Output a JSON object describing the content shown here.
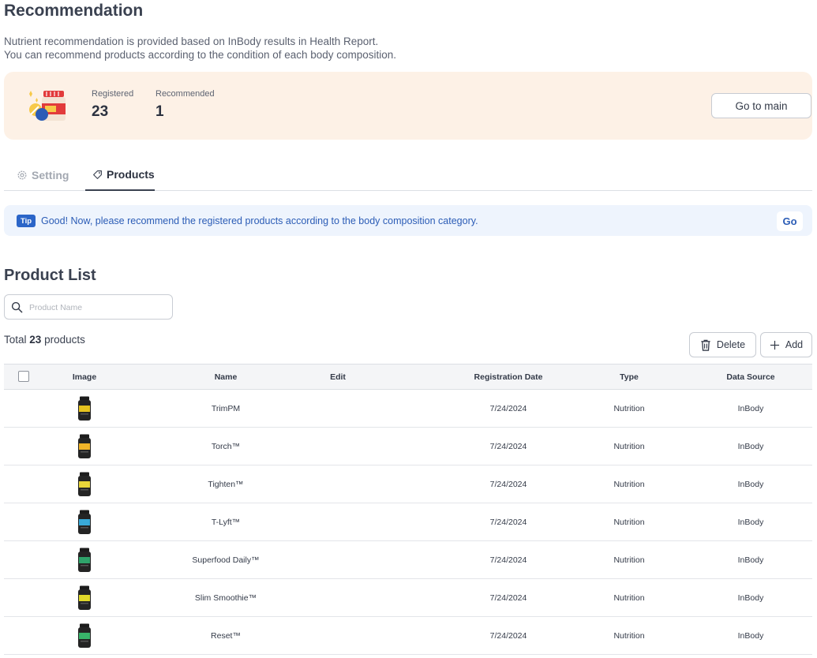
{
  "header": {
    "title": "Recommendation",
    "desc_line1": "Nutrient recommendation is provided based on InBody results in Health Report.",
    "desc_line2": "You can recommend products according to the condition of each body composition."
  },
  "summary": {
    "registered_label": "Registered",
    "registered_value": "23",
    "recommended_label": "Recommended",
    "recommended_value": "1",
    "go_main_label": "Go to main",
    "illustration_icon": "supplement-bottle-pills-icon"
  },
  "tabs": {
    "setting": "Setting",
    "products": "Products",
    "active": "products"
  },
  "tip": {
    "badge": "Tip",
    "text": "Good! Now, please recommend the registered products according to the body composition category.",
    "go_label": "Go"
  },
  "product_list": {
    "title": "Product List",
    "search_placeholder": "Product Name",
    "total_prefix": "Total",
    "total_count": "23",
    "total_suffix": "products",
    "delete_label": "Delete",
    "add_label": "Add",
    "columns": {
      "image": "Image",
      "name": "Name",
      "edit": "Edit",
      "date": "Registration Date",
      "type": "Type",
      "source": "Data Source"
    },
    "rows": [
      {
        "name": "TrimPM",
        "date": "7/24/2024",
        "type": "Nutrition",
        "source": "InBody",
        "label_color": "#e6c31f"
      },
      {
        "name": "Torch™",
        "date": "7/24/2024",
        "type": "Nutrition",
        "source": "InBody",
        "label_color": "#f0b429"
      },
      {
        "name": "Tighten™",
        "date": "7/24/2024",
        "type": "Nutrition",
        "source": "InBody",
        "label_color": "#e8d53a"
      },
      {
        "name": "T-Lyft™",
        "date": "7/24/2024",
        "type": "Nutrition",
        "source": "InBody",
        "label_color": "#39a9d8"
      },
      {
        "name": "Superfood Daily™",
        "date": "7/24/2024",
        "type": "Nutrition",
        "source": "InBody",
        "label_color": "#2fa36b"
      },
      {
        "name": "Slim Smoothie™",
        "date": "7/24/2024",
        "type": "Nutrition",
        "source": "InBody",
        "label_color": "#e1d92a"
      },
      {
        "name": "Reset™",
        "date": "7/24/2024",
        "type": "Nutrition",
        "source": "InBody",
        "label_color": "#38b36a"
      }
    ]
  },
  "colors": {
    "summary_bg": "#fdf1e6",
    "tip_bg": "#eef4fd",
    "tip_accent": "#2b65c8"
  }
}
